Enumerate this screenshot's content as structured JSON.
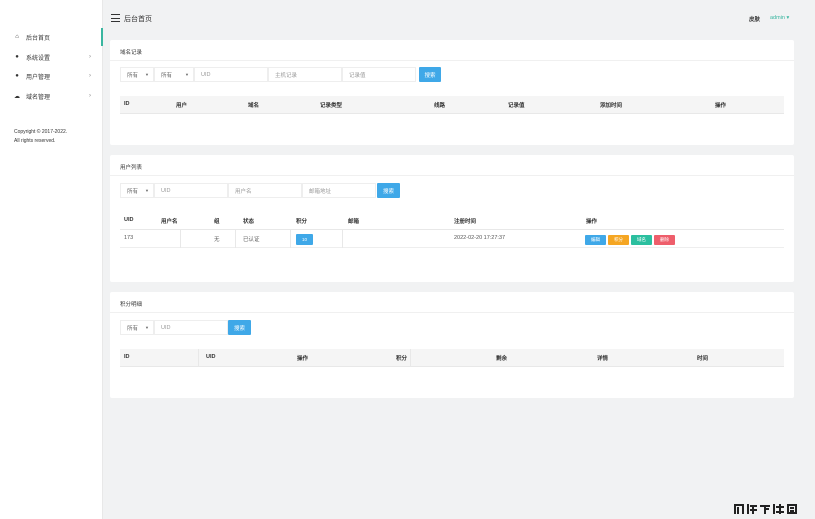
{
  "sidebar": {
    "items": [
      {
        "label": "后台首页",
        "icon": "home-icon",
        "glyph": "⌂"
      },
      {
        "label": "系统设置",
        "icon": "palette-icon",
        "glyph": "●",
        "chev": "›"
      },
      {
        "label": "用户管理",
        "icon": "user-icon",
        "glyph": "●",
        "chev": "›"
      },
      {
        "label": "域名管理",
        "icon": "cloud-icon",
        "glyph": "☁",
        "chev": "›"
      }
    ],
    "copyright_1": "Copyright © 2017-2022.",
    "copyright_2": "All rights reserved."
  },
  "header": {
    "title": "后台首页",
    "theme": "皮肤",
    "user": "admin ▾"
  },
  "domain_records": {
    "title": "域名记录",
    "filter_all": "所有",
    "filter_all_2": "所有",
    "uid_placeholder": "UID",
    "host_placeholder": "主机记录",
    "value_placeholder": "记录值",
    "search_label": "搜索",
    "columns": [
      "ID",
      "用户",
      "域名",
      "记录类型",
      "线路",
      "记录值",
      "添加时间",
      "操作"
    ]
  },
  "user_list": {
    "title": "用户列表",
    "filter_all": "所有",
    "uid_placeholder": "UID",
    "username_placeholder": "用户名",
    "email_placeholder": "邮箱地址",
    "search_label": "搜索",
    "columns": [
      "UID",
      "用户名",
      "组",
      "状态",
      "积分",
      "邮箱",
      "注册时间",
      "操作"
    ],
    "rows": [
      {
        "uid": "173",
        "username": "",
        "group": "无",
        "status": "已认证",
        "points": "10",
        "email": "",
        "reg_time": "2022-02-20 17:27:37"
      }
    ],
    "actions": {
      "edit": "编辑",
      "points": "积分",
      "domain": "域名",
      "delete": "删除"
    }
  },
  "points_detail": {
    "title": "积分明细",
    "filter_all": "所有",
    "uid_placeholder": "UID",
    "search_label": "搜索",
    "columns": [
      "ID",
      "UID",
      "操作",
      "积分",
      "剩余",
      "详情",
      "时间"
    ]
  },
  "colors": {
    "accent": "#3ab6a0",
    "primary": "#3fa8e8",
    "warning": "#f5a623",
    "success": "#2bbf9f",
    "danger": "#ee5e6b"
  }
}
